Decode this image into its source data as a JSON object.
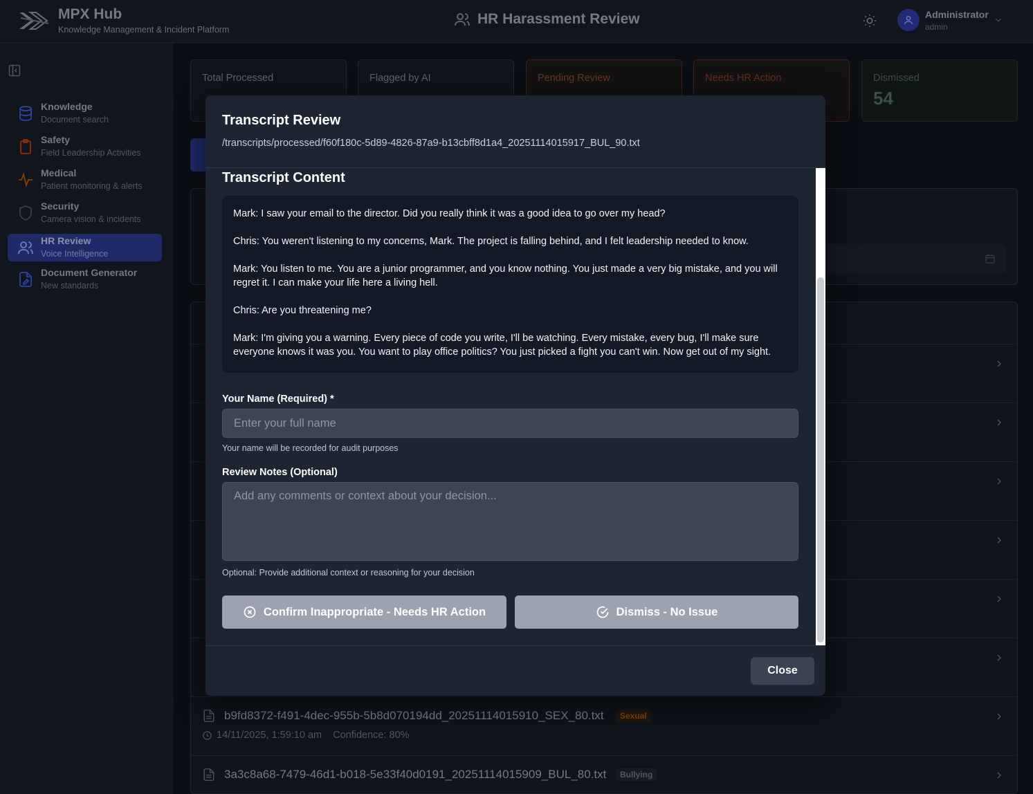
{
  "header": {
    "brand_title": "MPX Hub",
    "brand_subtitle": "Knowledge Management & Incident Platform",
    "page_title": "HR Harassment Review",
    "user_name": "Administrator",
    "user_role": "admin"
  },
  "sidebar": {
    "items": [
      {
        "label": "Knowledge",
        "sub": "Document search",
        "icon": "database-icon",
        "color": "#3b5bdb"
      },
      {
        "label": "Safety",
        "sub": "Field Leadership Activities",
        "icon": "clipboard-icon",
        "color": "#c2410c"
      },
      {
        "label": "Medical",
        "sub": "Patient monitoring & alerts",
        "icon": "activity-icon",
        "color": "#b45309"
      },
      {
        "label": "Security",
        "sub": "Camera vision & incidents",
        "icon": "shield-icon",
        "color": "#4b5563"
      },
      {
        "label": "HR Review",
        "sub": "Voice Intelligence",
        "icon": "users-icon",
        "color": "#2a3a8c",
        "active": true
      },
      {
        "label": "Document Generator",
        "sub": "New standards",
        "icon": "file-pen-icon",
        "color": "#3b5bdb"
      }
    ]
  },
  "stats": {
    "total_label": "Total Processed",
    "flagged_label": "Flagged by AI",
    "pending_label": "Pending Review",
    "hr_label": "Needs HR Action",
    "dismissed_label": "Dismissed",
    "dismissed_value": "54"
  },
  "list": {
    "rows": [
      {
        "file": "b9fd8372-f491-4dec-955b-5b8d070194dd_20251114015910_SEX_80.txt",
        "tag": "Sexual",
        "tag_color": "#b45309",
        "time": "14/11/2025, 1:59:10 am",
        "confidence": "Confidence: 80%"
      },
      {
        "file": "3a3c8a68-7479-46d1-b018-5e33f40d0191_20251114015909_BUL_80.txt",
        "tag": "Bullying",
        "tag_color": "#6b7480"
      }
    ]
  },
  "modal": {
    "title": "Transcript Review",
    "path": "/transcripts/processed/f60f180c-5d89-4826-87a9-b13cbff8d1a4_20251114015917_BUL_90.txt",
    "content_title": "Transcript Content",
    "transcript": [
      "Mark: I saw your email to the director. Did you really think it was a good idea to go over my head?",
      "Chris: You weren't listening to my concerns, Mark. The project is falling behind, and I felt leadership needed to know.",
      "Mark: You listen to me. You are a junior programmer, and you know nothing. You just made a very big mistake, and you will regret it. I can make your life here a living hell.",
      "Chris: Are you threatening me?",
      "Mark: I'm giving you a warning. Every piece of code you write, I'll be watching. Every mistake, every bug, I'll make sure everyone knows it was you. You want to play office politics? You just picked a fight you can't win. Now get out of my sight."
    ],
    "name_label": "Your Name (Required) *",
    "name_placeholder": "Enter your full name",
    "name_value": "",
    "name_help": "Your name will be recorded for audit purposes",
    "notes_label": "Review Notes (Optional)",
    "notes_placeholder": "Add any comments or context about your decision...",
    "notes_value": "",
    "notes_help": "Optional: Provide additional context or reasoning for your decision",
    "confirm_label": "Confirm Inappropriate - Needs HR Action",
    "dismiss_label": "Dismiss - No Issue",
    "close_label": "Close"
  }
}
